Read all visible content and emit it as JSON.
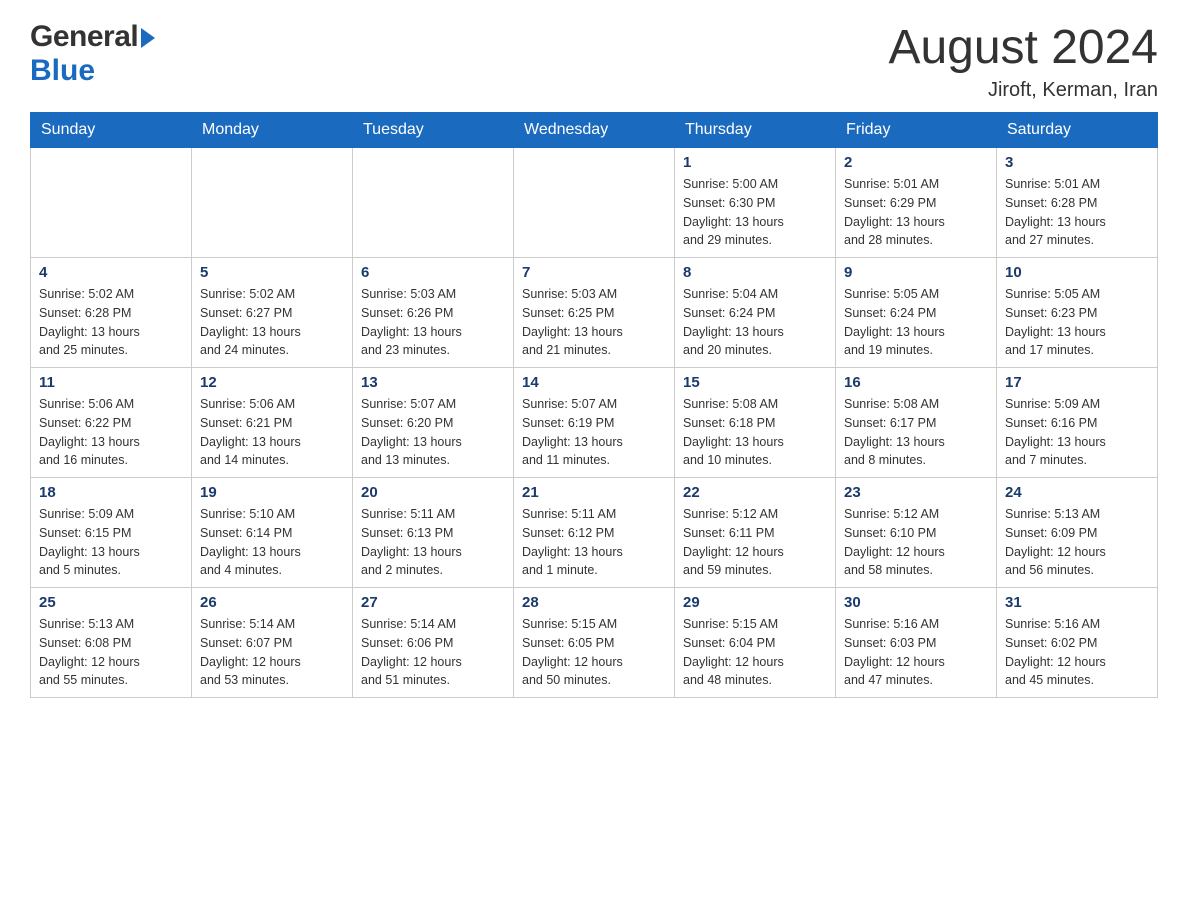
{
  "header": {
    "logo_general": "General",
    "logo_arrow": "▶",
    "logo_blue": "Blue",
    "month_title": "August 2024",
    "location": "Jiroft, Kerman, Iran"
  },
  "weekdays": [
    "Sunday",
    "Monday",
    "Tuesday",
    "Wednesday",
    "Thursday",
    "Friday",
    "Saturday"
  ],
  "weeks": [
    [
      {
        "day": "",
        "info": ""
      },
      {
        "day": "",
        "info": ""
      },
      {
        "day": "",
        "info": ""
      },
      {
        "day": "",
        "info": ""
      },
      {
        "day": "1",
        "info": "Sunrise: 5:00 AM\nSunset: 6:30 PM\nDaylight: 13 hours\nand 29 minutes."
      },
      {
        "day": "2",
        "info": "Sunrise: 5:01 AM\nSunset: 6:29 PM\nDaylight: 13 hours\nand 28 minutes."
      },
      {
        "day": "3",
        "info": "Sunrise: 5:01 AM\nSunset: 6:28 PM\nDaylight: 13 hours\nand 27 minutes."
      }
    ],
    [
      {
        "day": "4",
        "info": "Sunrise: 5:02 AM\nSunset: 6:28 PM\nDaylight: 13 hours\nand 25 minutes."
      },
      {
        "day": "5",
        "info": "Sunrise: 5:02 AM\nSunset: 6:27 PM\nDaylight: 13 hours\nand 24 minutes."
      },
      {
        "day": "6",
        "info": "Sunrise: 5:03 AM\nSunset: 6:26 PM\nDaylight: 13 hours\nand 23 minutes."
      },
      {
        "day": "7",
        "info": "Sunrise: 5:03 AM\nSunset: 6:25 PM\nDaylight: 13 hours\nand 21 minutes."
      },
      {
        "day": "8",
        "info": "Sunrise: 5:04 AM\nSunset: 6:24 PM\nDaylight: 13 hours\nand 20 minutes."
      },
      {
        "day": "9",
        "info": "Sunrise: 5:05 AM\nSunset: 6:24 PM\nDaylight: 13 hours\nand 19 minutes."
      },
      {
        "day": "10",
        "info": "Sunrise: 5:05 AM\nSunset: 6:23 PM\nDaylight: 13 hours\nand 17 minutes."
      }
    ],
    [
      {
        "day": "11",
        "info": "Sunrise: 5:06 AM\nSunset: 6:22 PM\nDaylight: 13 hours\nand 16 minutes."
      },
      {
        "day": "12",
        "info": "Sunrise: 5:06 AM\nSunset: 6:21 PM\nDaylight: 13 hours\nand 14 minutes."
      },
      {
        "day": "13",
        "info": "Sunrise: 5:07 AM\nSunset: 6:20 PM\nDaylight: 13 hours\nand 13 minutes."
      },
      {
        "day": "14",
        "info": "Sunrise: 5:07 AM\nSunset: 6:19 PM\nDaylight: 13 hours\nand 11 minutes."
      },
      {
        "day": "15",
        "info": "Sunrise: 5:08 AM\nSunset: 6:18 PM\nDaylight: 13 hours\nand 10 minutes."
      },
      {
        "day": "16",
        "info": "Sunrise: 5:08 AM\nSunset: 6:17 PM\nDaylight: 13 hours\nand 8 minutes."
      },
      {
        "day": "17",
        "info": "Sunrise: 5:09 AM\nSunset: 6:16 PM\nDaylight: 13 hours\nand 7 minutes."
      }
    ],
    [
      {
        "day": "18",
        "info": "Sunrise: 5:09 AM\nSunset: 6:15 PM\nDaylight: 13 hours\nand 5 minutes."
      },
      {
        "day": "19",
        "info": "Sunrise: 5:10 AM\nSunset: 6:14 PM\nDaylight: 13 hours\nand 4 minutes."
      },
      {
        "day": "20",
        "info": "Sunrise: 5:11 AM\nSunset: 6:13 PM\nDaylight: 13 hours\nand 2 minutes."
      },
      {
        "day": "21",
        "info": "Sunrise: 5:11 AM\nSunset: 6:12 PM\nDaylight: 13 hours\nand 1 minute."
      },
      {
        "day": "22",
        "info": "Sunrise: 5:12 AM\nSunset: 6:11 PM\nDaylight: 12 hours\nand 59 minutes."
      },
      {
        "day": "23",
        "info": "Sunrise: 5:12 AM\nSunset: 6:10 PM\nDaylight: 12 hours\nand 58 minutes."
      },
      {
        "day": "24",
        "info": "Sunrise: 5:13 AM\nSunset: 6:09 PM\nDaylight: 12 hours\nand 56 minutes."
      }
    ],
    [
      {
        "day": "25",
        "info": "Sunrise: 5:13 AM\nSunset: 6:08 PM\nDaylight: 12 hours\nand 55 minutes."
      },
      {
        "day": "26",
        "info": "Sunrise: 5:14 AM\nSunset: 6:07 PM\nDaylight: 12 hours\nand 53 minutes."
      },
      {
        "day": "27",
        "info": "Sunrise: 5:14 AM\nSunset: 6:06 PM\nDaylight: 12 hours\nand 51 minutes."
      },
      {
        "day": "28",
        "info": "Sunrise: 5:15 AM\nSunset: 6:05 PM\nDaylight: 12 hours\nand 50 minutes."
      },
      {
        "day": "29",
        "info": "Sunrise: 5:15 AM\nSunset: 6:04 PM\nDaylight: 12 hours\nand 48 minutes."
      },
      {
        "day": "30",
        "info": "Sunrise: 5:16 AM\nSunset: 6:03 PM\nDaylight: 12 hours\nand 47 minutes."
      },
      {
        "day": "31",
        "info": "Sunrise: 5:16 AM\nSunset: 6:02 PM\nDaylight: 12 hours\nand 45 minutes."
      }
    ]
  ]
}
